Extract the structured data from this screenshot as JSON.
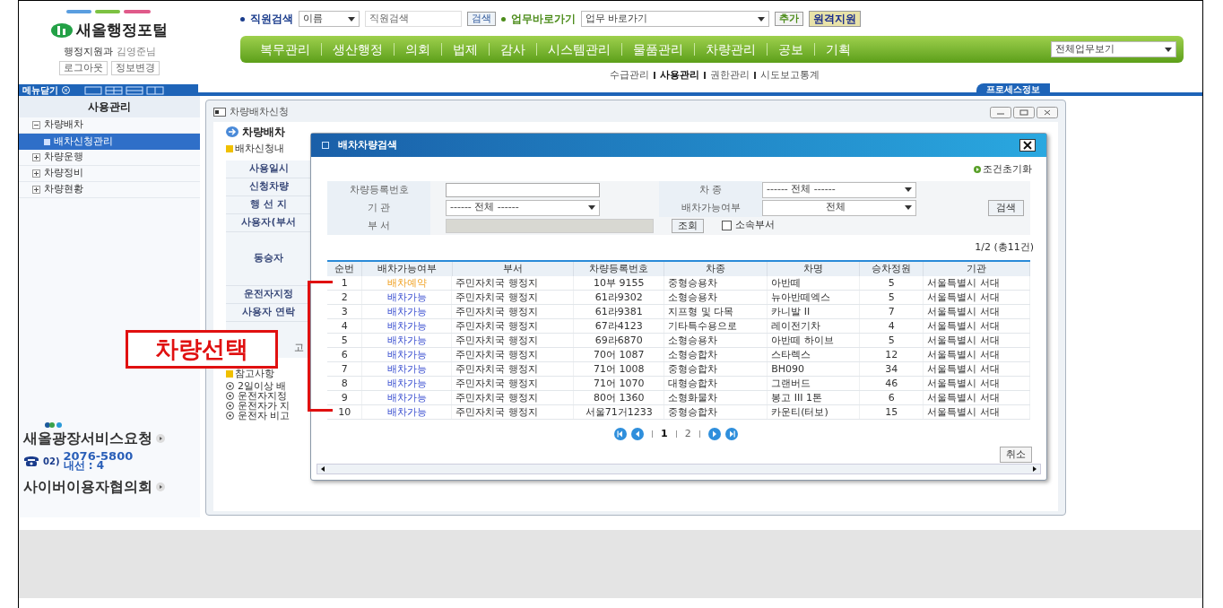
{
  "header": {
    "logo_text": "새올행정포털",
    "user_dept": "행정지원과",
    "user_name": "김영준님",
    "user_buttons": [
      "로그아웃",
      "정보변경"
    ]
  },
  "staff_search": {
    "label": "직원검색",
    "select": "이름",
    "value": "직원검색",
    "button": "검색"
  },
  "shortcut": {
    "label": "업무바로가기",
    "select": "업무 바로가기",
    "add_button": "추가",
    "remote_button": "원격지원"
  },
  "main_nav": {
    "items": [
      "복무관리",
      "생산행정",
      "의회",
      "법제",
      "감사",
      "시스템관리",
      "물품관리",
      "차량관리",
      "공보",
      "기획"
    ],
    "select": "전체업무보기"
  },
  "sub_nav": [
    {
      "label": "수급관리",
      "selected": false
    },
    {
      "label": "사용관리",
      "selected": true
    },
    {
      "label": "권한관리",
      "selected": false
    },
    {
      "label": "시도보고통계",
      "selected": false
    }
  ],
  "tab_bar": {
    "menu_close": "메뉴닫기",
    "process_tab": "프로세스정보"
  },
  "sidebar": {
    "title": "사용관리",
    "tree": [
      {
        "label": "차량배차",
        "expanded": true,
        "selected": false,
        "children": [
          {
            "label": "배차신청관리",
            "selected": true
          }
        ]
      },
      {
        "label": "차량운행",
        "expanded": false,
        "selected": false
      },
      {
        "label": "차량정비",
        "expanded": false,
        "selected": false
      },
      {
        "label": "차량현황",
        "expanded": false,
        "selected": false
      }
    ],
    "service_link": "새올광장서비스요청",
    "phone_prefix": "02)",
    "phone_number": "2076-5800",
    "phone_ext": "내선 : 4",
    "council_link": "사이버이용자협의회"
  },
  "panel": {
    "title": "차량배차신청",
    "heading": "차량배차",
    "section": "배차신청내",
    "form_labels": [
      "사용일시",
      "신청차량",
      "행 선 지",
      "사용자(부서",
      "동승자",
      "운전자지정",
      "사용자 연락"
    ],
    "last_label": "고",
    "notes_title": "참고사항",
    "notes": [
      "2일이상 배",
      "운전자지정",
      "운전자가 지",
      "운전자 비고"
    ]
  },
  "modal": {
    "title": "배차차량검색",
    "reset_link": "조건초기화",
    "form": {
      "reg_label": "차량등록번호",
      "type_label": "차 종",
      "type_select": "------ 전체 ------",
      "org_label": "기 관",
      "org_select": "------ 전체 ------",
      "avail_label": "배차가능여부",
      "avail_select": "전체",
      "dept_label": "부 서",
      "lookup_button": "조회",
      "own_dept": {
        "label": "소속부서",
        "checked": false
      },
      "search_button": "검색"
    },
    "count": "1/2 (총11건)",
    "table": {
      "columns": [
        "순번",
        "배차가능여부",
        "부서",
        "차량등록번호",
        "차종",
        "차명",
        "승차정원",
        "기관"
      ],
      "rows": [
        {
          "no": "1",
          "status": "배차예약",
          "kind": "reserved",
          "dept": "주민자치국 행정지",
          "reg": "10부 9155",
          "type": "중형승용차",
          "name": "아반떼",
          "seats": "5",
          "org": "서울특별시 서대"
        },
        {
          "no": "2",
          "status": "배차가능",
          "kind": "available",
          "dept": "주민자치국 행정지",
          "reg": "61라9302",
          "type": "소형승용차",
          "name": "뉴아반떼엑스",
          "seats": "5",
          "org": "서울특별시 서대"
        },
        {
          "no": "3",
          "status": "배차가능",
          "kind": "available",
          "dept": "주민자치국 행정지",
          "reg": "61라9381",
          "type": "지프형 및 다목",
          "name": "카니발 II",
          "seats": "7",
          "org": "서울특별시 서대"
        },
        {
          "no": "4",
          "status": "배차가능",
          "kind": "available",
          "dept": "주민자치국 행정지",
          "reg": "67라4123",
          "type": "기타특수용으로",
          "name": "레이전기차",
          "seats": "4",
          "org": "서울특별시 서대"
        },
        {
          "no": "5",
          "status": "배차가능",
          "kind": "available",
          "dept": "주민자치국 행정지",
          "reg": "69라6870",
          "type": "소형승용차",
          "name": "아반떼 하이브",
          "seats": "5",
          "org": "서울특별시 서대"
        },
        {
          "no": "6",
          "status": "배차가능",
          "kind": "available",
          "dept": "주민자치국 행정지",
          "reg": "70어 1087",
          "type": "소형승합차",
          "name": "스타렉스",
          "seats": "12",
          "org": "서울특별시 서대"
        },
        {
          "no": "7",
          "status": "배차가능",
          "kind": "available",
          "dept": "주민자치국 행정지",
          "reg": "71어 1008",
          "type": "중형승합차",
          "name": "BH090",
          "seats": "34",
          "org": "서울특별시 서대"
        },
        {
          "no": "8",
          "status": "배차가능",
          "kind": "available",
          "dept": "주민자치국 행정지",
          "reg": "71어 1070",
          "type": "대형승합차",
          "name": "그랜버드",
          "seats": "46",
          "org": "서울특별시 서대"
        },
        {
          "no": "9",
          "status": "배차가능",
          "kind": "available",
          "dept": "주민자치국 행정지",
          "reg": "80어 1360",
          "type": "소형화물차",
          "name": "봉고 III 1톤",
          "seats": "6",
          "org": "서울특별시 서대"
        },
        {
          "no": "10",
          "status": "배차가능",
          "kind": "available",
          "dept": "주민자치국 행정지",
          "reg": "서울71거1233",
          "type": "중형승합차",
          "name": "카운티(터보)",
          "seats": "15",
          "org": "서울특별시 서대"
        }
      ]
    },
    "pages": [
      {
        "label": "1",
        "selected": true
      },
      {
        "label": "2",
        "selected": false
      }
    ],
    "cancel_button": "취소"
  },
  "annotation": {
    "label": "차량선택"
  }
}
